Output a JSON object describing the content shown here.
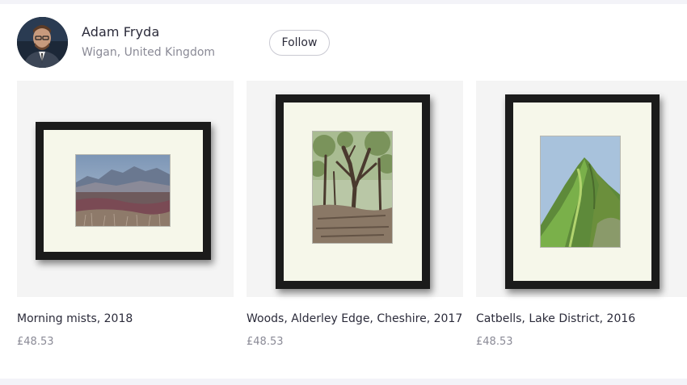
{
  "artist": {
    "name": "Adam Fryda",
    "location": "Wigan, United Kingdom",
    "follow_label": "Follow"
  },
  "products": [
    {
      "title": "Morning mists, 2018",
      "price": "£48.53"
    },
    {
      "title": "Woods, Alderley Edge, Cheshire, 2017",
      "price": "£48.53"
    },
    {
      "title": "Catbells, Lake District, 2016",
      "price": "£48.53"
    }
  ]
}
